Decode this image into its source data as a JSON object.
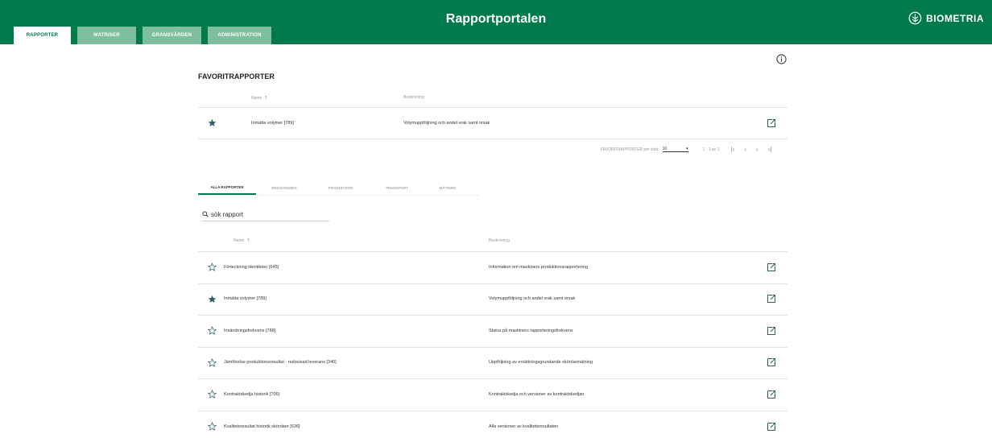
{
  "header": {
    "tabs": [
      {
        "label": "RAPPORTER",
        "active": true
      },
      {
        "label": "MATRISER",
        "active": false
      },
      {
        "label": "GRÄNSVÄRDEN",
        "active": false
      },
      {
        "label": "ADMINISTRATION",
        "active": false
      }
    ],
    "title": "Rapportportalen",
    "brand": "BIOMETRIA"
  },
  "colors": {
    "brand_green": "#007a4b",
    "tab_inactive": "#7fbf9f",
    "star": "#2f5d62"
  },
  "icons": {
    "info": "info-icon",
    "open": "open-external-icon",
    "favorite": "star-icon",
    "search": "search-icon"
  },
  "favorites": {
    "title": "FAVORITRAPPORTER",
    "columns": {
      "name": "Namn",
      "description": "Beskrivning"
    },
    "rows": [
      {
        "name": "Inmätta volymer [789]",
        "description": "Volymuppföljning och andel vrak samt orsak",
        "favorite": true
      }
    ],
    "pager": {
      "per_page_label": "FAVORITRAPPORTER per sida:",
      "per_page": "10",
      "range": "1 - 1 av 1"
    }
  },
  "category_tabs": [
    {
      "label": "ALLA RAPPORTER",
      "active": true
    },
    {
      "label": "REDOVISNING",
      "active": false
    },
    {
      "label": "PRODUKTION",
      "active": false
    },
    {
      "label": "TRANSPORT",
      "active": false
    },
    {
      "label": "MÄTNING",
      "active": false
    }
  ],
  "search": {
    "placeholder": "sök rapport"
  },
  "reports": {
    "columns": {
      "name": "Namn",
      "description": "Beskrivning"
    },
    "rows": [
      {
        "name": "Förteckning identiteter [645]",
        "description": "Information om maskiners produktionsrapportering",
        "favorite": false
      },
      {
        "name": "Inmätta volymer [789]",
        "description": "Volymuppföljning och andel vrak samt orsak",
        "favorite": true
      },
      {
        "name": "Insändningsfrekvens [788]",
        "description": "Status på maskiners rapporteringsfrekvens",
        "favorite": false
      },
      {
        "name": "Jämförelse produktionsresultat - redovisad leverans [340]",
        "description": "Uppföljning av ersättningsgrundande skördarmätning",
        "favorite": false
      },
      {
        "name": "Kontraktskedja historik [706]",
        "description": "Kontraktskedja och versioner av kontraktskedjan",
        "favorite": false
      },
      {
        "name": "Kvalitetsresultat historik skördare [636]",
        "description": "Alla versioner av kvalitetsresultaten",
        "favorite": false
      }
    ]
  }
}
